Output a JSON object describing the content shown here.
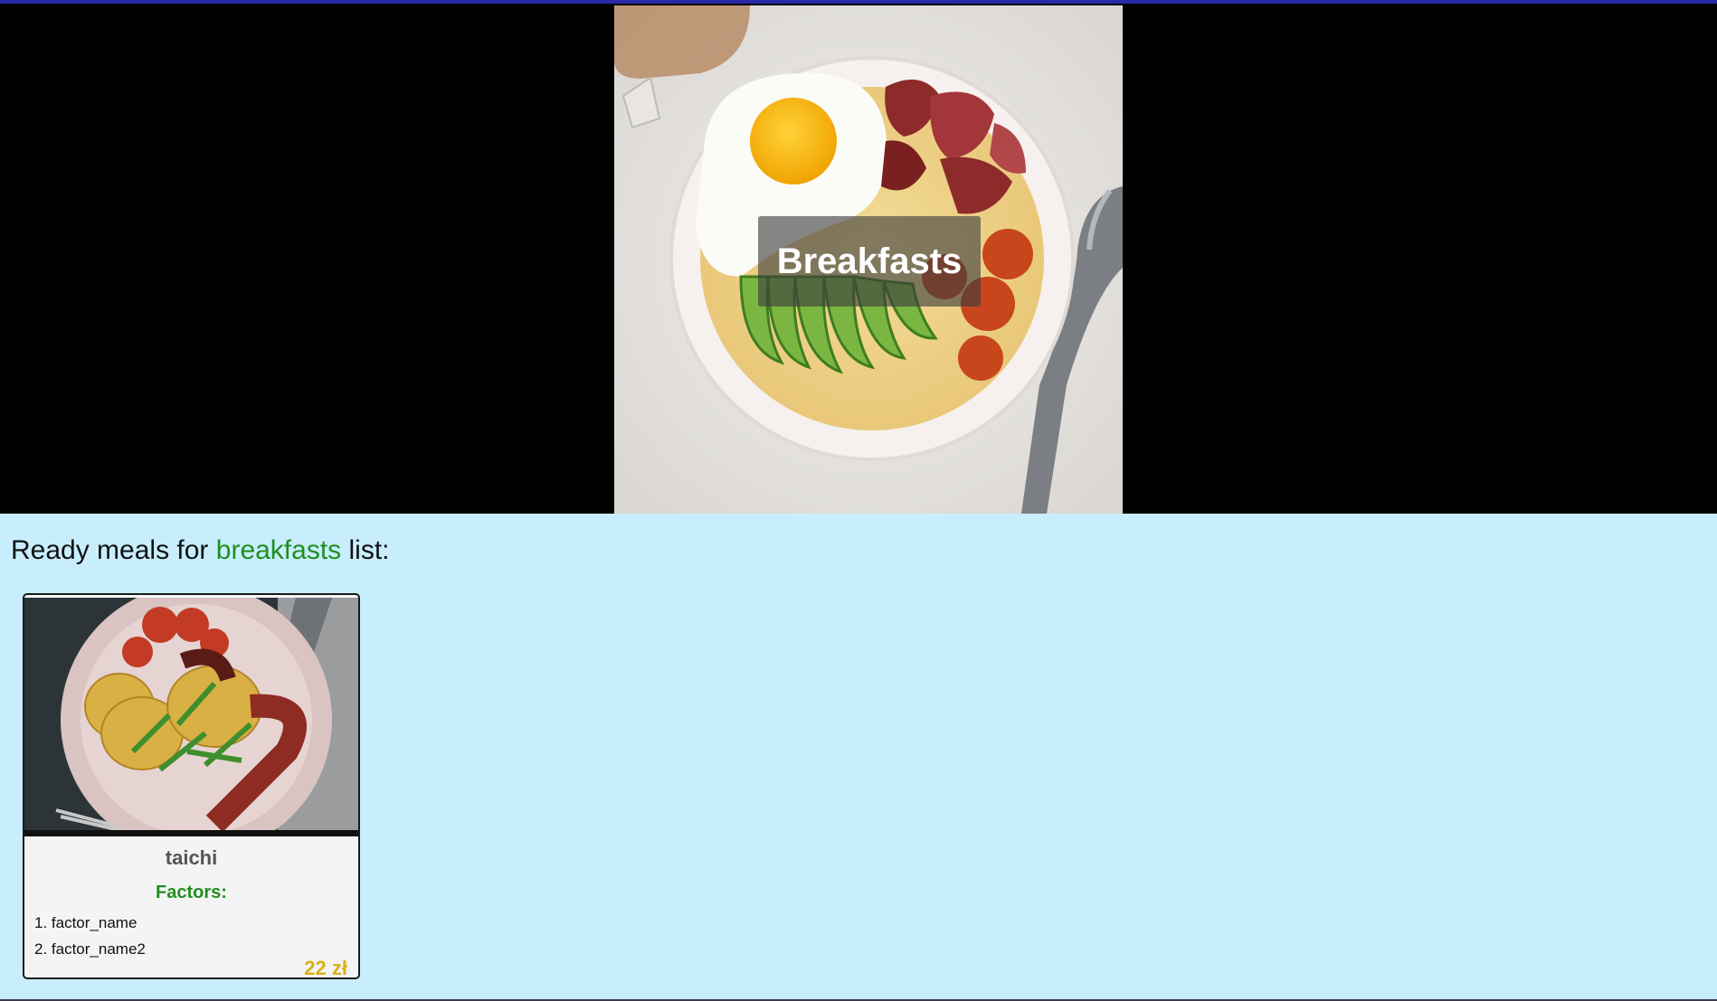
{
  "hero": {
    "title": "Breakfasts",
    "image": "breakfast-bowl-photo"
  },
  "section": {
    "heading_prefix": "Ready meals for ",
    "heading_category": "breakfasts",
    "heading_suffix": " list:"
  },
  "meals": [
    {
      "name": "taichi",
      "image": "pancakes-bacon-tomatoes-photo",
      "factors_label": "Factors:",
      "factors": [
        "1. factor_name",
        "2. factor_name2"
      ],
      "price": "22 zł"
    }
  ],
  "colors": {
    "accent_green": "#1f8f1f",
    "price_gold": "#d6b21a",
    "content_bg": "#c8eefe",
    "hero_bg": "#000000"
  }
}
